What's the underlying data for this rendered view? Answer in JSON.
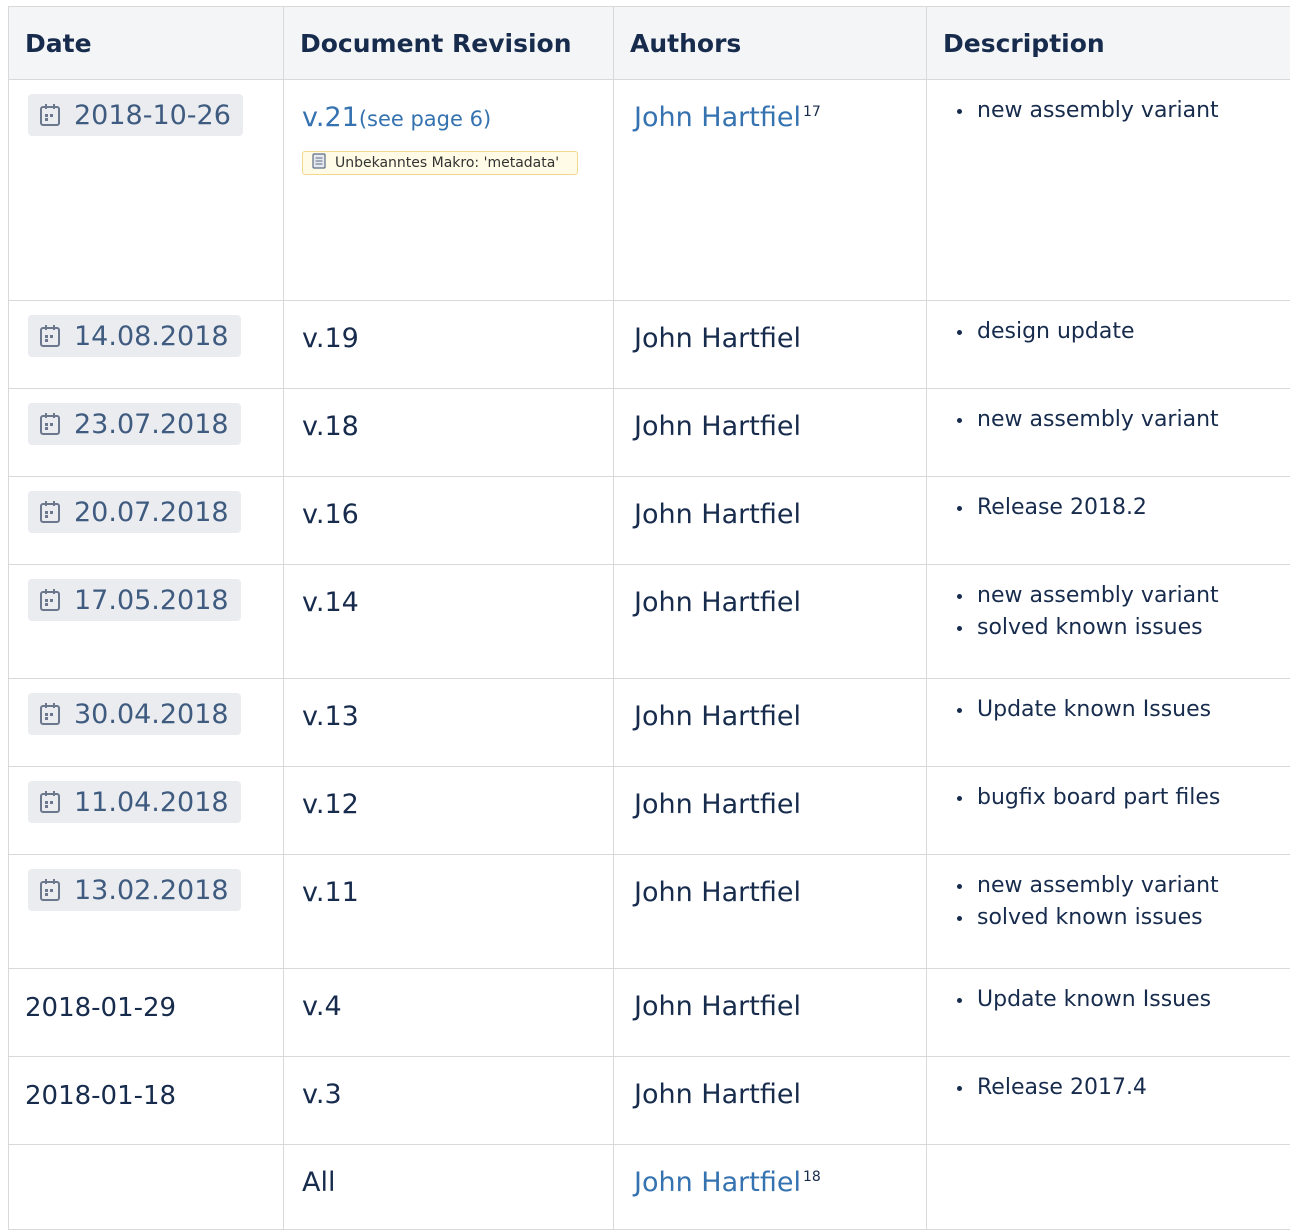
{
  "table": {
    "headers": [
      "Date",
      "Document Revision",
      "Authors",
      "Description"
    ],
    "rows": [
      {
        "date": "2018-10-26",
        "date_style": "lozenge",
        "revision": "v.21",
        "revision_link": true,
        "revision_note": "(see page 6)",
        "macro_text": "Unbekanntes Makro: 'metadata'",
        "author": "John Hartfiel",
        "author_link": true,
        "author_footnote": "17",
        "description": [
          "new assembly variant"
        ]
      },
      {
        "date": "14.08.2018",
        "date_style": "lozenge",
        "revision": "v.19",
        "author": "John Hartfiel",
        "description": [
          "design update"
        ]
      },
      {
        "date": "23.07.2018",
        "date_style": "lozenge",
        "revision": "v.18",
        "author": "John Hartfiel",
        "description": [
          "new assembly variant"
        ]
      },
      {
        "date": "20.07.2018",
        "date_style": "lozenge",
        "revision": "v.16",
        "author": "John Hartfiel",
        "description": [
          "Release 2018.2"
        ]
      },
      {
        "date": "17.05.2018",
        "date_style": "lozenge",
        "revision": "v.14",
        "author": "John Hartfiel",
        "description": [
          "new assembly variant",
          "solved known issues"
        ]
      },
      {
        "date": "30.04.2018",
        "date_style": "lozenge",
        "revision": "v.13",
        "author": "John Hartfiel",
        "description": [
          "Update known Issues"
        ]
      },
      {
        "date": "11.04.2018",
        "date_style": "lozenge",
        "revision": "v.12",
        "author": "John Hartfiel",
        "description": [
          "bugfix board part files"
        ]
      },
      {
        "date": "13.02.2018",
        "date_style": "lozenge",
        "revision": "v.11",
        "author": "John Hartfiel",
        "description": [
          "new assembly variant",
          "solved known issues"
        ]
      },
      {
        "date": "2018-01-29",
        "date_style": "plain",
        "revision": "v.4",
        "author": "John Hartfiel",
        "description": [
          "Update known Issues"
        ]
      },
      {
        "date": "2018-01-18",
        "date_style": "plain",
        "revision": "v.3",
        "author": "John Hartfiel",
        "description": [
          "Release 2017.4"
        ]
      },
      {
        "date": "",
        "date_style": "plain",
        "revision": "All",
        "author": "John Hartfiel",
        "author_link": true,
        "author_footnote": "18",
        "description": []
      }
    ]
  },
  "icons": {
    "date": "calendar-icon",
    "macro": "page-icon"
  },
  "colors": {
    "link": "#3572b0",
    "lozenge_bg": "#ebecf0",
    "lozenge_text": "#3f5c80",
    "header_bg": "#f4f5f7",
    "border": "#d9d9d9",
    "macro_bg": "#fffbe6",
    "macro_border": "#f0d98c"
  }
}
